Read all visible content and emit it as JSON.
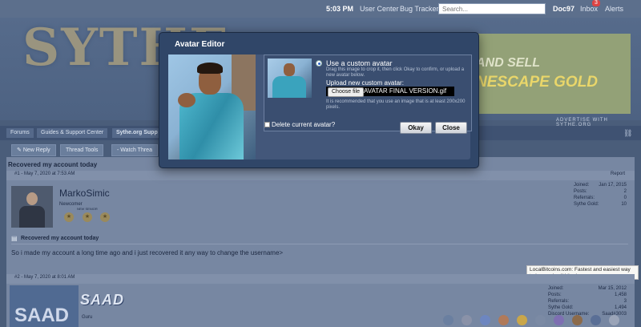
{
  "topbar": {
    "clock": "5:03 PM",
    "user_center": "User Center",
    "bug_tracker": "Bug Tracker",
    "search_placeholder": "Search...",
    "username": "Doc97",
    "inbox": "Inbox",
    "inbox_badge": "3",
    "alerts": "Alerts"
  },
  "header": {
    "logo": "SYTHE",
    "ad_line1": "AND SELL",
    "ad_line2": "NESCAPE GOLD",
    "ad_caption": "ADVERTISE WITH SYTHE.ORG"
  },
  "breadcrumbs": [
    "Forums",
    "Guides & Support Center",
    "Sythe.org Supp"
  ],
  "toolbar": {
    "new_reply": "New Reply",
    "thread_tools": "Thread Tools",
    "watch_thread": "- Watch Threa"
  },
  "thread": {
    "title": "Recovered my account today",
    "report": "Report",
    "posts": [
      {
        "meta": "#1 - May 7, 2020 at 7:53 AM",
        "username": "MarkoSimic",
        "role": "Newcomer",
        "rank": "NEW SENIOR",
        "stats": [
          {
            "label": "Joined:",
            "value": "Jan 17, 2015"
          },
          {
            "label": "Posts:",
            "value": "2"
          },
          {
            "label": "Referrals:",
            "value": "0"
          },
          {
            "label": "Sythe Gold:",
            "value": "10"
          }
        ],
        "title": "Recovered my account today",
        "message": "So i made my account a long time ago and i just recovered it any way to change the username>"
      },
      {
        "meta": "#2 - May 7, 2020 at 8:01 AM",
        "username": "SAAD",
        "avatar_text": "SAAD",
        "role": "Guru",
        "stats": [
          {
            "label": "Joined:",
            "value": "Mar 15, 2012"
          },
          {
            "label": "Posts:",
            "value": "1,458"
          },
          {
            "label": "Referrals:",
            "value": "3"
          },
          {
            "label": "Sythe Gold:",
            "value": "1,494"
          },
          {
            "label": "Discord Username:",
            "value": "Saad#3003"
          }
        ]
      }
    ],
    "tooltip": "LocalBitcoins.com: Fastest and easiest way to buy and sell bitcoins"
  },
  "modal": {
    "title": "Avatar Editor",
    "option_custom": "Use a custom avatar",
    "option_custom_hint": "Drag this image to crop it, then click Okay to confirm, or upload a new avatar below.",
    "upload_label": "Upload new custom avatar:",
    "choose_file": "Choose file",
    "file_name": "AVATAR FINAL VERSION.gif",
    "recommend_hint": "It is recommended that you use an image that is at least 200x200 pixels.",
    "delete_label": "Delete current avatar?",
    "okay": "Okay",
    "close": "Close"
  },
  "colors": {
    "overlay": "#4a5d7a",
    "modal_bg": "#304668",
    "accent": "#2a62c9"
  }
}
